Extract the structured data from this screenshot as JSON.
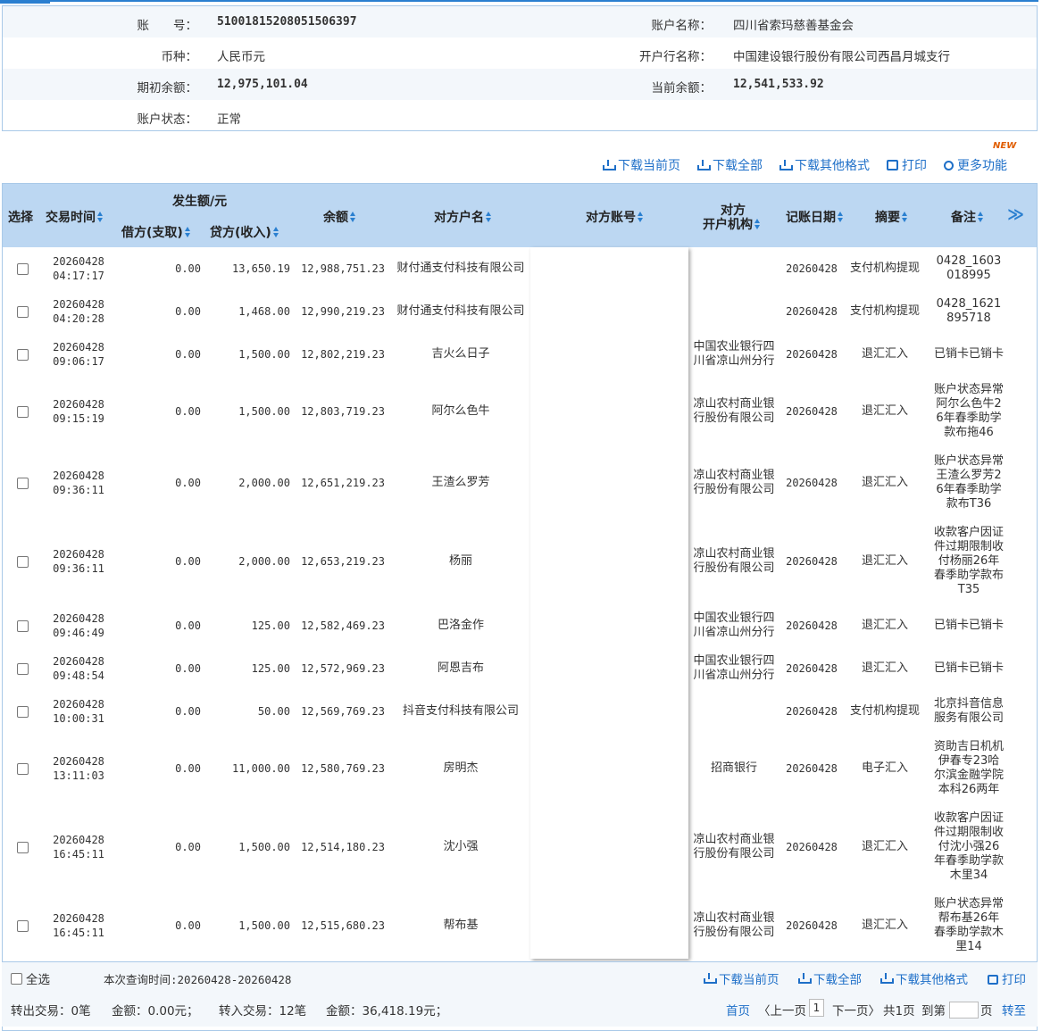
{
  "account": {
    "account_no_label": "账　　号：",
    "account_no": "51001815208051506397",
    "account_name_label": "账户名称：",
    "account_name": "四川省索玛慈善基金会",
    "currency_label": "币种：",
    "currency": "人民币元",
    "bank_label": "开户行名称：",
    "bank": "中国建设银行股份有限公司西昌月城支行",
    "opening_balance_label": "期初余额：",
    "opening_balance": "12,975,101.04",
    "current_balance_label": "当前余额：",
    "current_balance": "12,541,533.92",
    "status_label": "账户状态：",
    "status": "正常"
  },
  "toolbar": {
    "download_page": "下载当前页",
    "download_all": "下载全部",
    "download_other": "下载其他格式",
    "print": "打印",
    "more": "更多功能",
    "new_badge": "NEW"
  },
  "table": {
    "headers": {
      "select": "选择",
      "time": "交易时间",
      "amount_group": "发生额/元",
      "debit": "借方(支取)",
      "credit": "贷方(收入)",
      "balance": "余额",
      "counterparty_name": "对方户名",
      "counterparty_account": "对方账号",
      "counterparty_bank_1": "对方",
      "counterparty_bank_2": "开户机构",
      "posting_date": "记账日期",
      "summary": "摘要",
      "remark": "备注",
      "more": "≫"
    },
    "rows": [
      {
        "date": "20260428",
        "time": "04:17:17",
        "debit": "0.00",
        "credit": "13,650.19",
        "balance": "12,988,751.23",
        "name": "财付通支付科技有限公司",
        "bank": "",
        "post": "20260428",
        "summary": "支付机构提现",
        "remark": "0428_1603018995"
      },
      {
        "date": "20260428",
        "time": "04:20:28",
        "debit": "0.00",
        "credit": "1,468.00",
        "balance": "12,990,219.23",
        "name": "财付通支付科技有限公司",
        "bank": "",
        "post": "20260428",
        "summary": "支付机构提现",
        "remark": "0428_1621895718"
      },
      {
        "date": "20260428",
        "time": "09:06:17",
        "debit": "0.00",
        "credit": "1,500.00",
        "balance": "12,802,219.23",
        "name": "吉火么日子",
        "bank": "中国农业银行四川省凉山州分行",
        "post": "20260428",
        "summary": "退汇汇入",
        "remark": "已销卡已销卡"
      },
      {
        "date": "20260428",
        "time": "09:15:19",
        "debit": "0.00",
        "credit": "1,500.00",
        "balance": "12,803,719.23",
        "name": "阿尔么色牛",
        "bank": "凉山农村商业银行股份有限公司",
        "post": "20260428",
        "summary": "退汇汇入",
        "remark": "账户状态异常阿尔么色牛26年春季助学款布拖46"
      },
      {
        "date": "20260428",
        "time": "09:36:11",
        "debit": "0.00",
        "credit": "2,000.00",
        "balance": "12,651,219.23",
        "name": "王渣么罗芳",
        "bank": "凉山农村商业银行股份有限公司",
        "post": "20260428",
        "summary": "退汇汇入",
        "remark": "账户状态异常王渣么罗芳26年春季助学款布T36"
      },
      {
        "date": "20260428",
        "time": "09:36:11",
        "debit": "0.00",
        "credit": "2,000.00",
        "balance": "12,653,219.23",
        "name": "杨丽",
        "bank": "凉山农村商业银行股份有限公司",
        "post": "20260428",
        "summary": "退汇汇入",
        "remark": "收款客户因证件过期限制收付杨丽26年春季助学款布T35"
      },
      {
        "date": "20260428",
        "time": "09:46:49",
        "debit": "0.00",
        "credit": "125.00",
        "balance": "12,582,469.23",
        "name": "巴洛金作",
        "bank": "中国农业银行四川省凉山州分行",
        "post": "20260428",
        "summary": "退汇汇入",
        "remark": "已销卡已销卡"
      },
      {
        "date": "20260428",
        "time": "09:48:54",
        "debit": "0.00",
        "credit": "125.00",
        "balance": "12,572,969.23",
        "name": "阿恩吉布",
        "bank": "中国农业银行四川省凉山州分行",
        "post": "20260428",
        "summary": "退汇汇入",
        "remark": "已销卡已销卡"
      },
      {
        "date": "20260428",
        "time": "10:00:31",
        "debit": "0.00",
        "credit": "50.00",
        "balance": "12,569,769.23",
        "name": "抖音支付科技有限公司",
        "bank": "",
        "post": "20260428",
        "summary": "支付机构提现",
        "remark": "北京抖音信息服务有限公司"
      },
      {
        "date": "20260428",
        "time": "13:11:03",
        "debit": "0.00",
        "credit": "11,000.00",
        "balance": "12,580,769.23",
        "name": "房明杰",
        "bank": "招商银行",
        "post": "20260428",
        "summary": "电子汇入",
        "remark": "资助吉日机机伊春专23哈尔滨金融学院本科26两年"
      },
      {
        "date": "20260428",
        "time": "16:45:11",
        "debit": "0.00",
        "credit": "1,500.00",
        "balance": "12,514,180.23",
        "name": "沈小强",
        "bank": "凉山农村商业银行股份有限公司",
        "post": "20260428",
        "summary": "退汇汇入",
        "remark": "收款客户因证件过期限制收付沈小强26年春季助学款木里34"
      },
      {
        "date": "20260428",
        "time": "16:45:11",
        "debit": "0.00",
        "credit": "1,500.00",
        "balance": "12,515,680.23",
        "name": "帮布基",
        "bank": "凉山农村商业银行股份有限公司",
        "post": "20260428",
        "summary": "退汇汇入",
        "remark": "账户状态异常帮布基26年春季助学款木里14"
      }
    ]
  },
  "footer": {
    "select_all": "全选",
    "query_range": "本次查询时间:20260428-20260428",
    "download_page": "下载当前页",
    "download_all": "下载全部",
    "download_other": "下载其他格式",
    "print": "打印",
    "out_count": "转出交易：0笔",
    "out_amount": "金额：0.00元；",
    "in_count": "转入交易：12笔",
    "in_amount": "金额：36,418.19元；",
    "first": "首页",
    "prev": "〈上一页",
    "page": "1",
    "next": "下一页〉",
    "total": "共1页",
    "goto_prefix": "到第",
    "goto_suffix": "页",
    "goto": "转至"
  }
}
